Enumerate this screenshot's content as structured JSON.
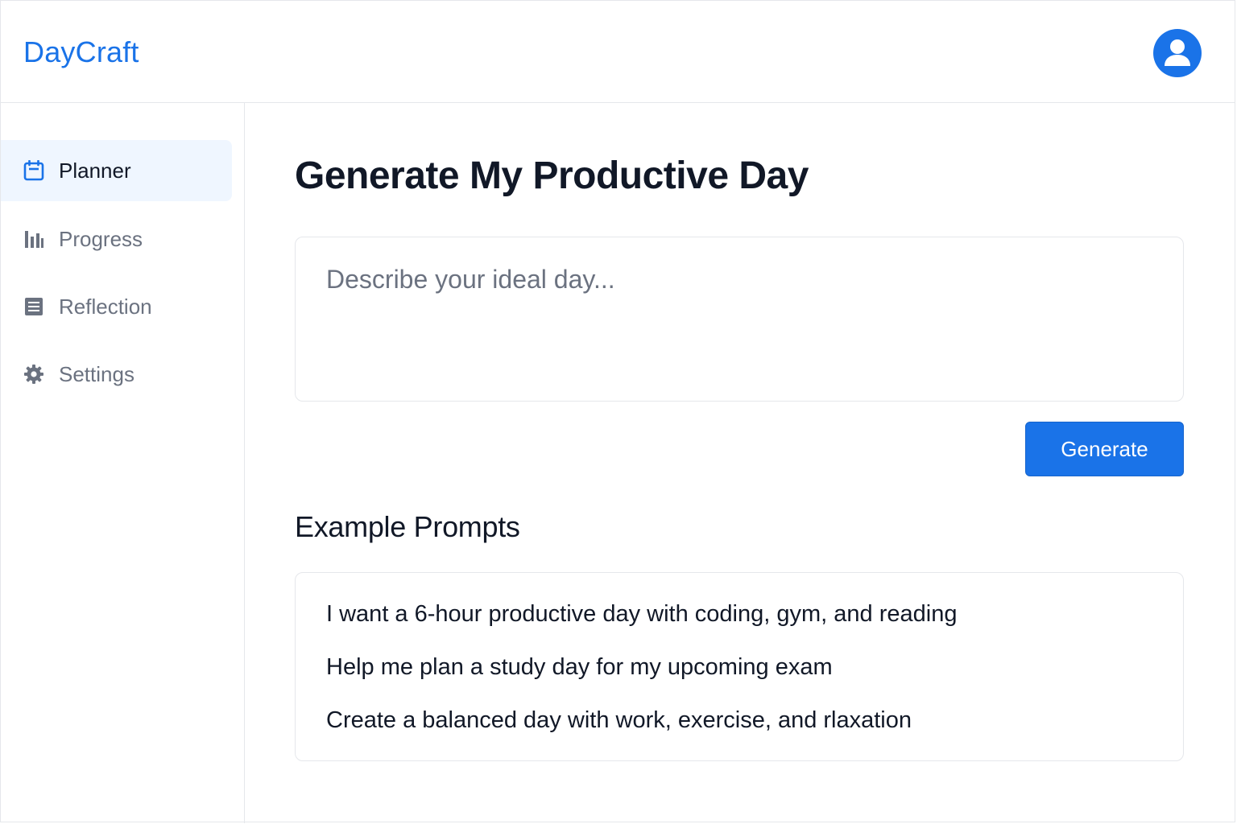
{
  "app": {
    "brand": "DayCraft"
  },
  "colors": {
    "accent": "#1a73e8",
    "active_nav_bg": "#eff6ff",
    "muted_text": "#6b7280",
    "border": "#e5e7eb"
  },
  "header": {
    "avatar_icon": "user-avatar-icon"
  },
  "sidebar": {
    "items": [
      {
        "label": "Planner",
        "icon": "calendar-icon",
        "active": true
      },
      {
        "label": "Progress",
        "icon": "bar-chart-icon",
        "active": false
      },
      {
        "label": "Reflection",
        "icon": "document-icon",
        "active": false
      },
      {
        "label": "Settings",
        "icon": "gear-icon",
        "active": false
      }
    ]
  },
  "main": {
    "title": "Generate My Productive Day",
    "prompt": {
      "value": "",
      "placeholder": "Describe your ideal day..."
    },
    "generate_label": "Generate",
    "examples_title": "Example Prompts",
    "examples": [
      "I want a 6-hour productive day with coding, gym, and reading",
      "Help me plan a study day for my upcoming exam",
      "Create a balanced day with work, exercise, and rlaxation"
    ]
  }
}
